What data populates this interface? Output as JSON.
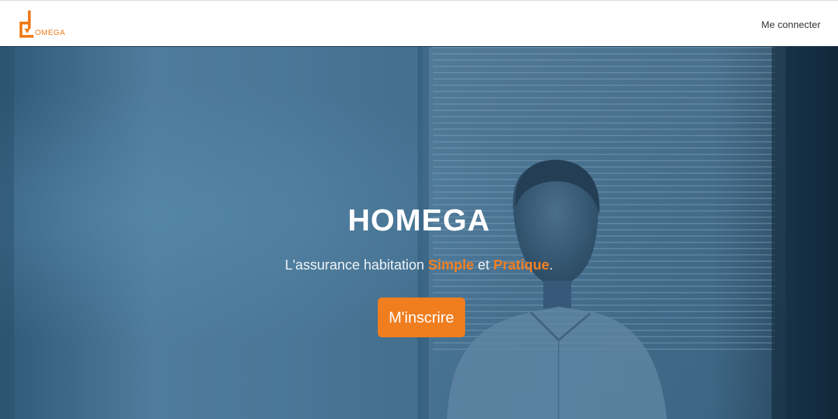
{
  "brand": {
    "logo_text": "OMEGA",
    "accent_color": "#f07e1f",
    "logo_icon": "house-logo-icon"
  },
  "nav": {
    "login_label": "Me connecter"
  },
  "hero": {
    "title": "HOMEGA",
    "tagline": {
      "prefix": "L'assurance habitation ",
      "highlight_1": "Simple",
      "middle": " et ",
      "highlight_2": "Pratique",
      "suffix": "."
    },
    "cta_label": "M'inscrire",
    "background_image": "woman-meditating-photo"
  }
}
